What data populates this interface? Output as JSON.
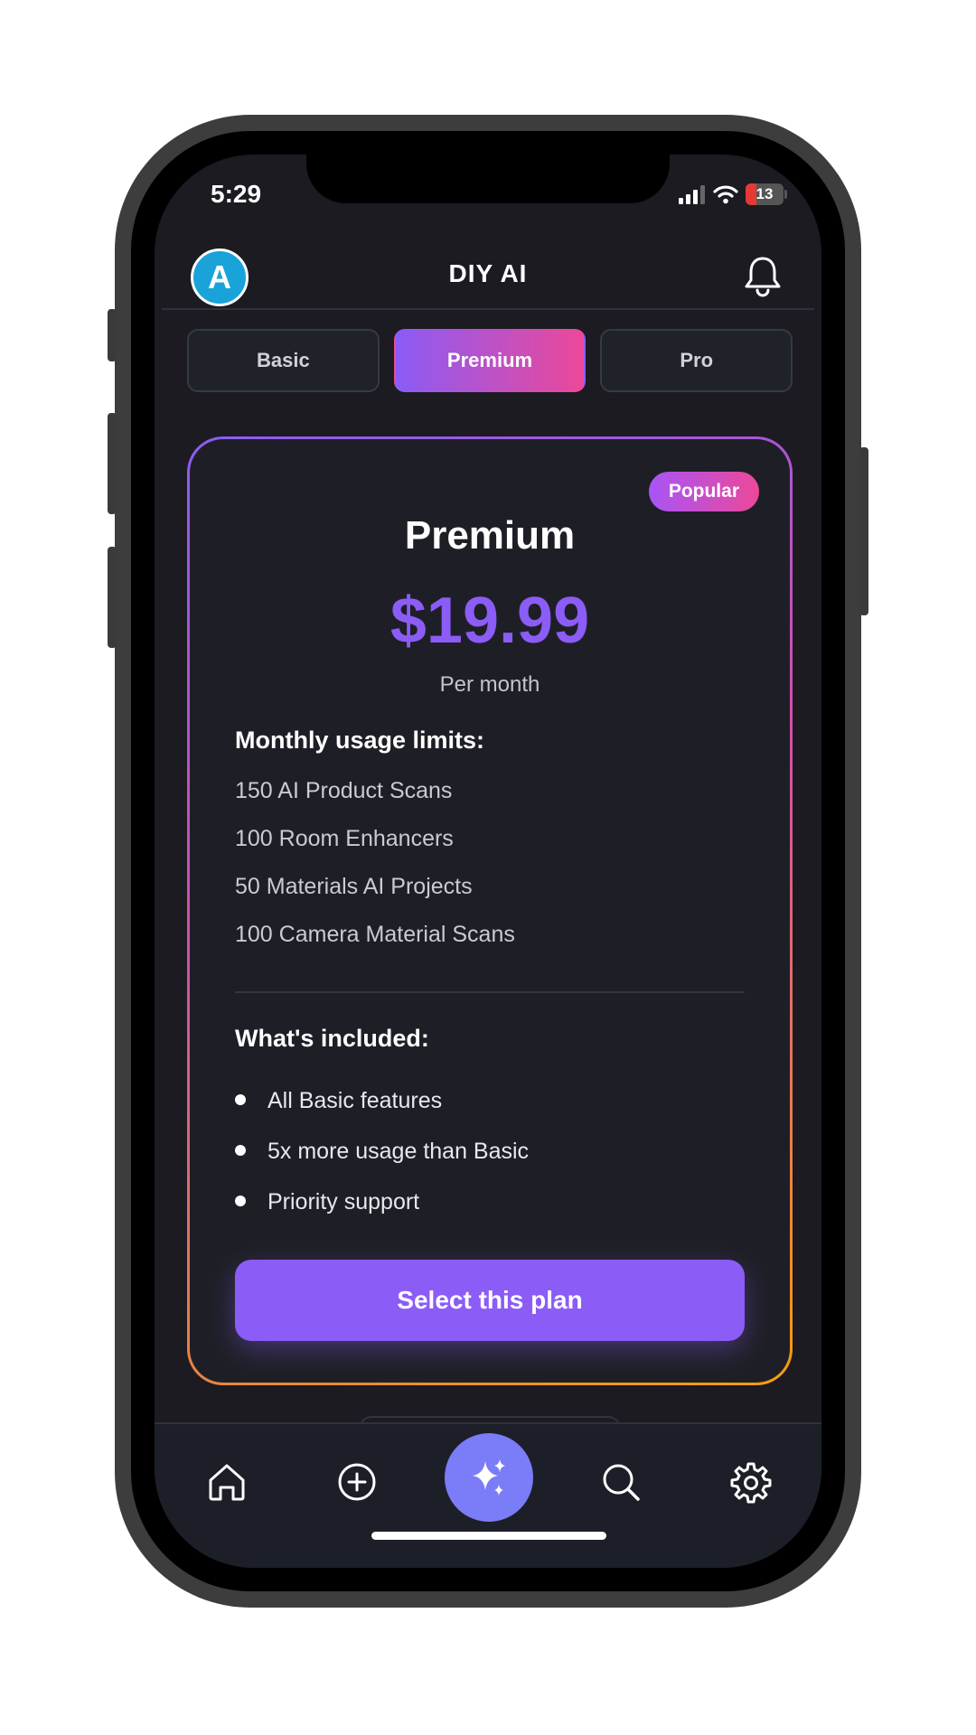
{
  "status": {
    "time": "5:29",
    "battery": "13"
  },
  "header": {
    "avatar_letter": "A",
    "title": "DIY AI"
  },
  "tabs": [
    {
      "label": "Basic",
      "active": false
    },
    {
      "label": "Premium",
      "active": true
    },
    {
      "label": "Pro",
      "active": false
    }
  ],
  "plan": {
    "badge": "Popular",
    "name": "Premium",
    "price": "$19.99",
    "period": "Per month",
    "limits_title": "Monthly usage limits:",
    "limits": [
      "150 AI Product Scans",
      "100 Room Enhancers",
      "50 Materials AI Projects",
      "100 Camera Material Scans"
    ],
    "included_title": "What's included:",
    "features": [
      "All Basic features",
      "5x more usage than Basic",
      "Priority support"
    ],
    "cta": "Select this plan"
  },
  "nav": [
    "home-icon",
    "add-icon",
    "sparkles-icon",
    "search-icon",
    "settings-icon"
  ],
  "colors": {
    "accent": "#8b5cf6",
    "pink": "#ec4899",
    "orange": "#f59e0b",
    "fab": "#7b7cf7",
    "background": "#1b1b21"
  }
}
